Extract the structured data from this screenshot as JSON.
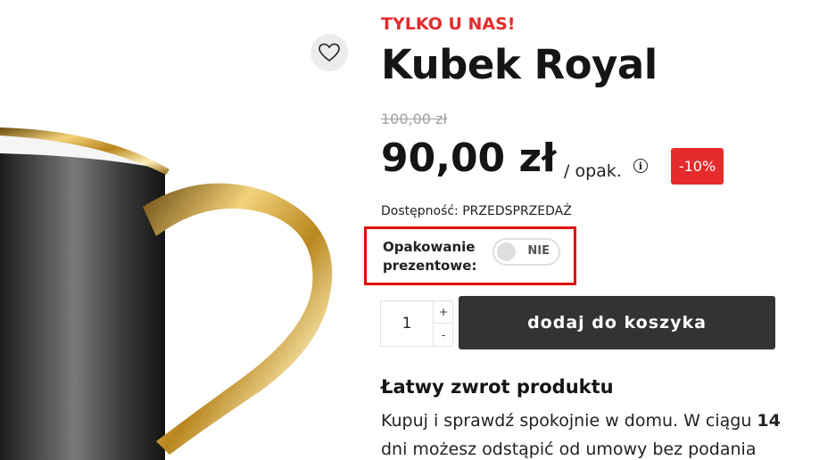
{
  "product": {
    "promo_label": "TYLKO U NAS!",
    "title": "Kubek Royal",
    "old_price": "100,00 zł",
    "current_price": "90,00 zł",
    "price_unit": "/ opak.",
    "discount_badge": "-10%",
    "availability": "Dostępność: PRZEDSPRZEDAŻ"
  },
  "icons": {
    "wishlist": "heart-icon",
    "info": "info-icon",
    "info_glyph": "i"
  },
  "gift_wrap": {
    "label_line1": "Opakowanie",
    "label_line2": "prezentowe:",
    "toggle_text": "NIE"
  },
  "cart": {
    "quantity": "1",
    "plus_label": "+",
    "minus_label": "-",
    "add_button": "dodaj do koszyka"
  },
  "returns": {
    "heading": "Łatwy zwrot produktu",
    "text_before": "Kupuj i sprawdź spokojnie w domu. W ciągu ",
    "text_bold": "14",
    "text_after": " dni możesz odstąpić od umowy bez podania"
  },
  "colors": {
    "accent_red": "#e52b2b",
    "button_dark": "#333333",
    "highlight_border": "#e01010",
    "mug_gold": "#c9a02a"
  }
}
